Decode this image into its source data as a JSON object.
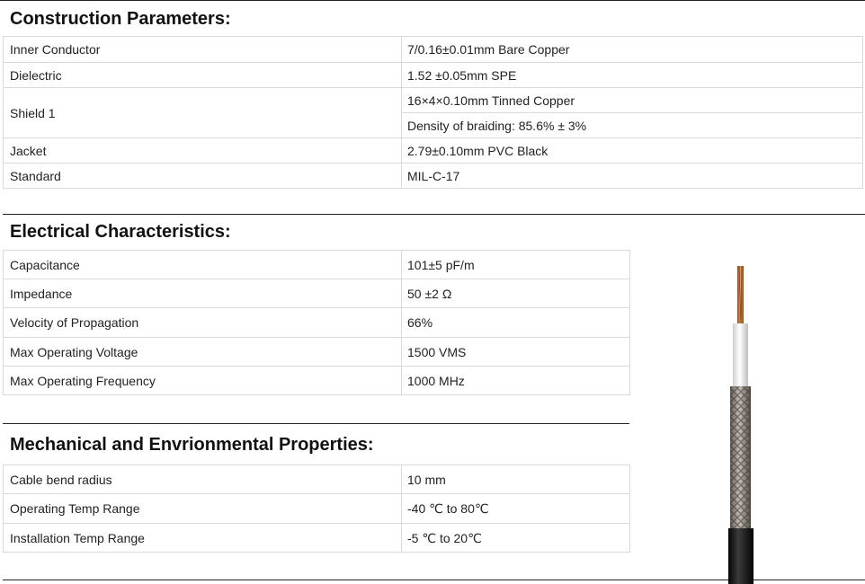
{
  "construction": {
    "title": "Construction Parameters:",
    "rows": [
      {
        "label": "Inner Conductor",
        "value": "7/0.16±0.01mm Bare Copper"
      },
      {
        "label": "Dielectric",
        "value": "1.52 ±0.05mm SPE"
      },
      {
        "label": "Shield 1",
        "values": [
          "16×4×0.10mm Tinned Copper",
          "Density of braiding: 85.6% ± 3%"
        ]
      },
      {
        "label": "Jacket",
        "value": "2.79±0.10mm PVC Black"
      },
      {
        "label": "Standard",
        "value": "MIL-C-17"
      }
    ]
  },
  "electrical": {
    "title": "Electrical Characteristics:",
    "rows": [
      {
        "label": "Capacitance",
        "value": "101±5 pF/m"
      },
      {
        "label": "Impedance",
        "value": "50 ±2 Ω"
      },
      {
        "label": "Velocity of Propagation",
        "value": "66%"
      },
      {
        "label": "Max Operating Voltage",
        "value": "1500 VMS"
      },
      {
        "label": "Max Operating Frequency",
        "value": "1000 MHz"
      }
    ]
  },
  "mechanical": {
    "title": "Mechanical and Envrionmental Properties:",
    "rows": [
      {
        "label": "Cable bend radius",
        "value": "10 mm"
      },
      {
        "label": "Operating Temp Range",
        "value": "-40 ℃ to 80℃"
      },
      {
        "label": "Installation Temp Range",
        "value": "-5 ℃ to 20℃"
      }
    ]
  },
  "image": {
    "subject": "coaxial-cable",
    "colors": {
      "copper": "#c8743a",
      "dielectric": "#f2f2f2",
      "braid": "#9a9388",
      "jacket": "#141414"
    }
  }
}
